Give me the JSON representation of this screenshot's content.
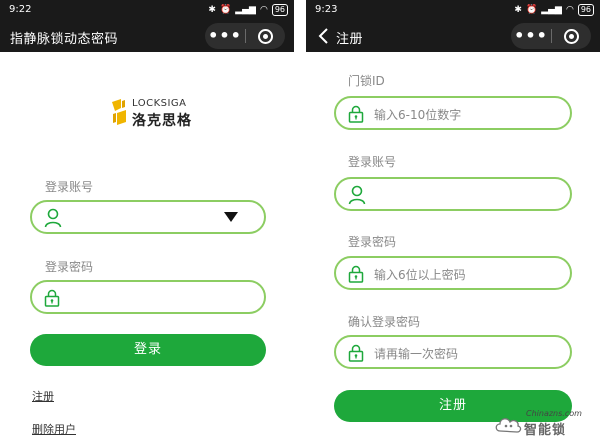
{
  "left": {
    "status": {
      "time": "9:22",
      "icons": [
        "bluetooth-icon",
        "alarm-icon",
        "signal-icon",
        "wifi-icon"
      ],
      "battery": "96"
    },
    "nav": {
      "title": "指静脉锁动态密码"
    },
    "logo": {
      "brand_en": "LOCKSIGA",
      "brand_cn": "洛克思格"
    },
    "form": {
      "account_label": "登录账号",
      "account_value": "",
      "password_label": "登录密码",
      "password_value": "",
      "login_button": "登录"
    },
    "links": {
      "register": "注册",
      "delete_user": "删除用户"
    }
  },
  "right": {
    "status": {
      "time": "9:23",
      "icons": [
        "bluetooth-icon",
        "alarm-icon",
        "signal-icon",
        "wifi-icon"
      ],
      "battery": "96"
    },
    "nav": {
      "title": "注册"
    },
    "form": {
      "lock_id_label": "门锁ID",
      "lock_id_placeholder": "输入6-10位数字",
      "account_label": "登录账号",
      "account_value": "",
      "password_label": "登录密码",
      "password_placeholder": "输入6位以上密码",
      "confirm_label": "确认登录密码",
      "confirm_placeholder": "请再输一次密码",
      "register_button": "注册"
    }
  },
  "watermark": {
    "site": "Chinazns.com",
    "name": "智能锁"
  },
  "colors": {
    "accent": "#1ea83b",
    "field_border": "#8ccd62",
    "bar": "#1a1a1a"
  }
}
